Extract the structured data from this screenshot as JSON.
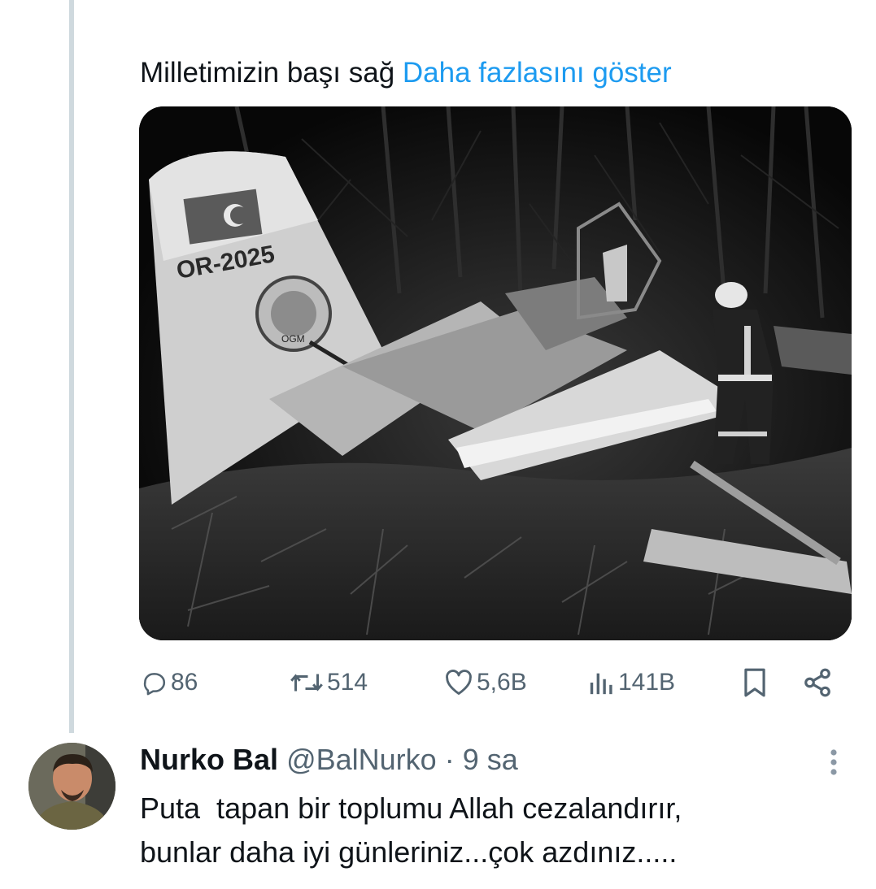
{
  "tweet": {
    "text": "Milletimizin başı sağ",
    "show_more_label": "Daha fazlasını göster",
    "image": {
      "tail_code": "OR-2025",
      "emblem_text": "OGM"
    },
    "actions": {
      "replies": "86",
      "retweets": "514",
      "likes": "5,6B",
      "views": "141B"
    }
  },
  "reply": {
    "name": "Nurko Bal",
    "handle": "@BalNurko",
    "separator": "·",
    "time": "9 sa",
    "line1": "Puta  tapan bir toplumu Allah cezalandırır,",
    "line2": "bunlar daha iyi günleriniz...çok azdınız....."
  },
  "icons": {
    "reply": "speech-bubble-icon",
    "retweet": "retweet-icon",
    "like": "heart-icon",
    "views": "bar-chart-icon",
    "bookmark": "bookmark-icon",
    "share": "share-icon",
    "more": "more-vertical-icon"
  },
  "colors": {
    "link": "#1d9bf0",
    "muted": "#536471",
    "thread": "#cfd9de"
  }
}
